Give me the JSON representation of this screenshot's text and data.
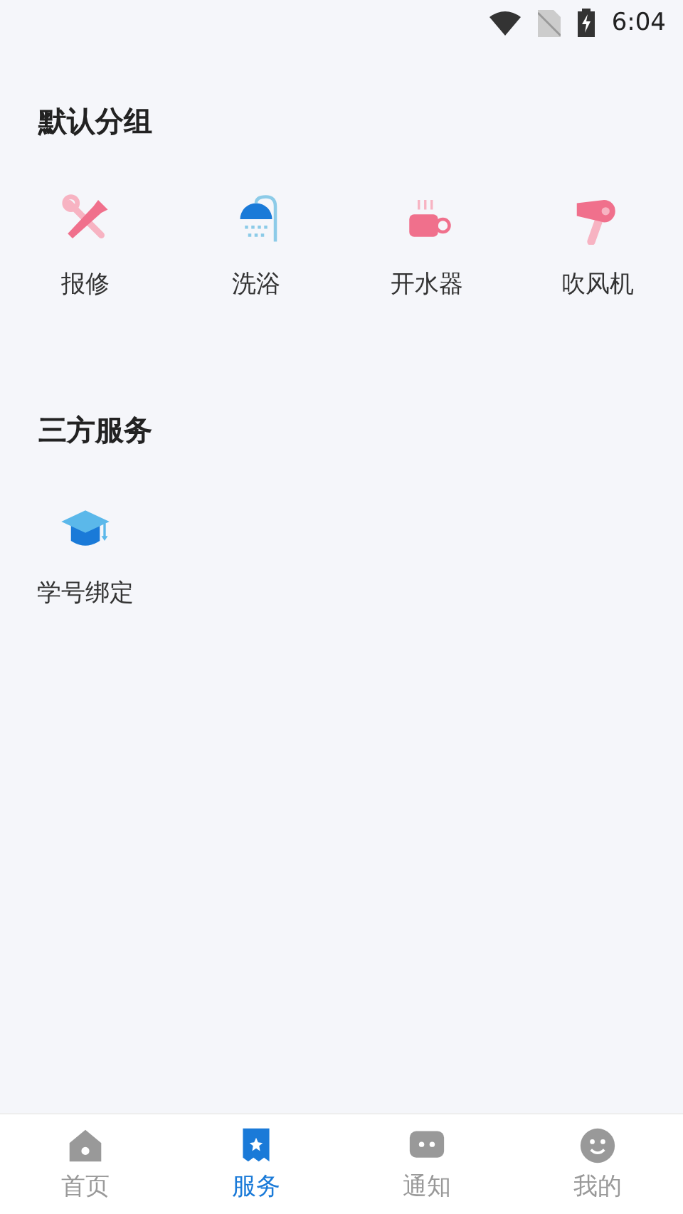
{
  "status_bar": {
    "time": "6:04"
  },
  "sections": [
    {
      "title": "默认分组",
      "items": [
        {
          "label": "报修",
          "kind": "repair"
        },
        {
          "label": "洗浴",
          "kind": "shower"
        },
        {
          "label": "开水器",
          "kind": "water"
        },
        {
          "label": "吹风机",
          "kind": "dryer"
        }
      ]
    },
    {
      "title": "三方服务",
      "items": [
        {
          "label": "学号绑定",
          "kind": "student"
        }
      ]
    }
  ],
  "tabs": [
    {
      "label": "首页",
      "kind": "home",
      "selected": false
    },
    {
      "label": "服务",
      "kind": "service",
      "selected": true
    },
    {
      "label": "通知",
      "kind": "notice",
      "selected": false
    },
    {
      "label": "我的",
      "kind": "me",
      "selected": false
    }
  ]
}
